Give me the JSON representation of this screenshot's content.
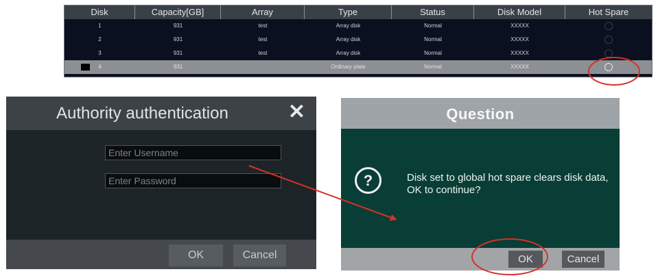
{
  "disk_table": {
    "headers": [
      "Disk",
      "Capacity[GB]",
      "Array",
      "Type",
      "Status",
      "Disk Model",
      "Hot Spare"
    ],
    "rows": [
      {
        "disk": "1",
        "capacity": "931",
        "array": "test",
        "type": "Array disk",
        "status": "Normal",
        "model": "XXXXX"
      },
      {
        "disk": "2",
        "capacity": "931",
        "array": "test",
        "type": "Array disk",
        "status": "Normal",
        "model": "XXXXX"
      },
      {
        "disk": "3",
        "capacity": "931",
        "array": "test",
        "type": "Array disk",
        "status": "Normal",
        "model": "XXXXX"
      },
      {
        "disk": "4",
        "capacity": "931",
        "array": "",
        "type": "Ordinary plate",
        "status": "Normal",
        "model": "XXXXX"
      }
    ]
  },
  "auth_dialog": {
    "title": "Authority authentication",
    "close_glyph": "✕",
    "username_placeholder": "Enter Username",
    "password_placeholder": "Enter Password",
    "ok_label": "OK",
    "cancel_label": "Cancel"
  },
  "question_dialog": {
    "title": "Question",
    "icon_glyph": "?",
    "message": "Disk set to global hot spare clears disk data, OK to continue?",
    "ok_label": "OK",
    "cancel_label": "Cancel"
  },
  "colors": {
    "annotation_red": "#d9302b",
    "question_bg": "#093e36",
    "auth_bg": "#1d2427"
  }
}
